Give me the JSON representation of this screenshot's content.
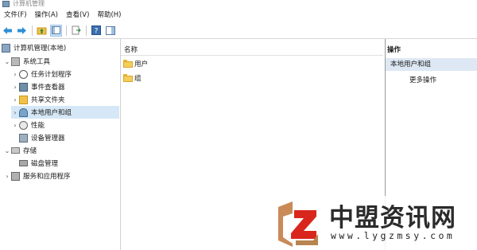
{
  "window": {
    "title": "计算机管理"
  },
  "menu": [
    "文件(F)",
    "操作(A)",
    "查看(V)",
    "帮助(H)"
  ],
  "tree": {
    "root": "计算机管理(本地)",
    "system_tools": "系统工具",
    "task_scheduler": "任务计划程序",
    "event_viewer": "事件查看器",
    "shared_folders": "共享文件夹",
    "local_users_groups": "本地用户和组",
    "performance": "性能",
    "device_manager": "设备管理器",
    "storage": "存储",
    "disk_management": "磁盘管理",
    "services_apps": "服务和应用程序"
  },
  "list": {
    "header_name": "名称",
    "items": [
      "用户",
      "组"
    ]
  },
  "actions": {
    "header": "操作",
    "section": "本地用户和组",
    "more": "更多操作"
  },
  "watermark": {
    "chinese": "中盟资讯网",
    "url": "www.lygzmsy.com"
  }
}
